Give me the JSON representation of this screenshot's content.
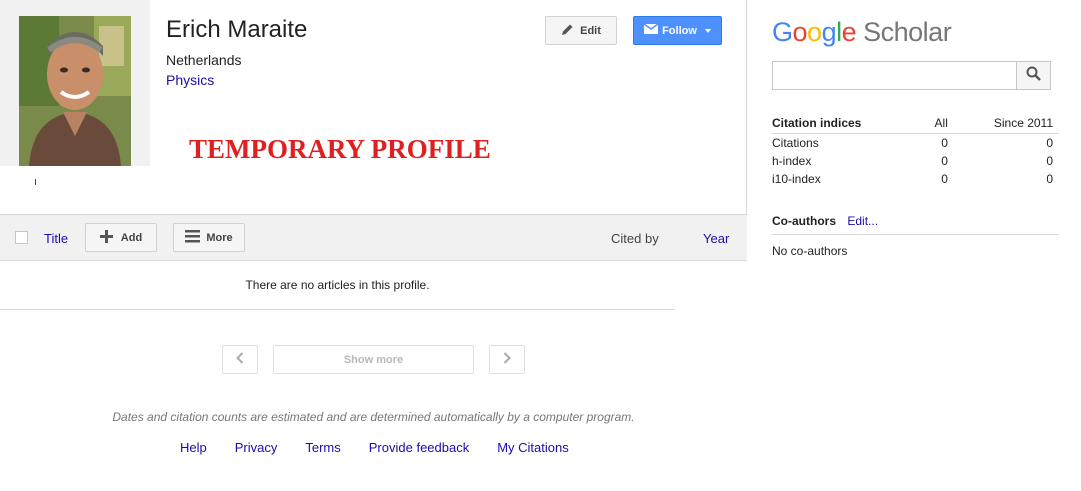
{
  "profile": {
    "name": "Erich Maraite",
    "affiliation": "Netherlands",
    "interest": "Physics",
    "banner": "TEMPORARY PROFILE",
    "edit_label": "Edit",
    "follow_label": "Follow"
  },
  "toolbar": {
    "title_label": "Title",
    "add_label": "Add",
    "more_label": "More",
    "cited_by_label": "Cited by",
    "year_label": "Year"
  },
  "articles": {
    "empty_message": "There are no articles in this profile."
  },
  "pagination": {
    "show_more_label": "Show more"
  },
  "disclaimer": "Dates and citation counts are estimated and are determined automatically by a computer program.",
  "footer": {
    "links": [
      "Help",
      "Privacy",
      "Terms",
      "Provide feedback",
      "My Citations"
    ]
  },
  "sidebar": {
    "logo_google": [
      "G",
      "o",
      "o",
      "g",
      "l",
      "e"
    ],
    "logo_scholar": "Scholar",
    "search_placeholder": "",
    "citation_indices": {
      "heading": "Citation indices",
      "col_all": "All",
      "col_since": "Since 2011",
      "rows": [
        {
          "label": "Citations",
          "all": "0",
          "since": "0"
        },
        {
          "label": "h-index",
          "all": "0",
          "since": "0"
        },
        {
          "label": "i10-index",
          "all": "0",
          "since": "0"
        }
      ]
    },
    "coauthors": {
      "heading": "Co-authors",
      "edit_label": "Edit...",
      "empty": "No co-authors"
    }
  },
  "colors": {
    "link": "#1a0dab",
    "follow_button": "#4d90fe",
    "banner_text": "#e02020",
    "toolbar_bg": "#f1f1f1"
  },
  "icons": [
    "pencil-icon",
    "envelope-icon",
    "plus-icon",
    "menu-icon",
    "chevron-left-icon",
    "chevron-right-icon",
    "search-icon"
  ]
}
